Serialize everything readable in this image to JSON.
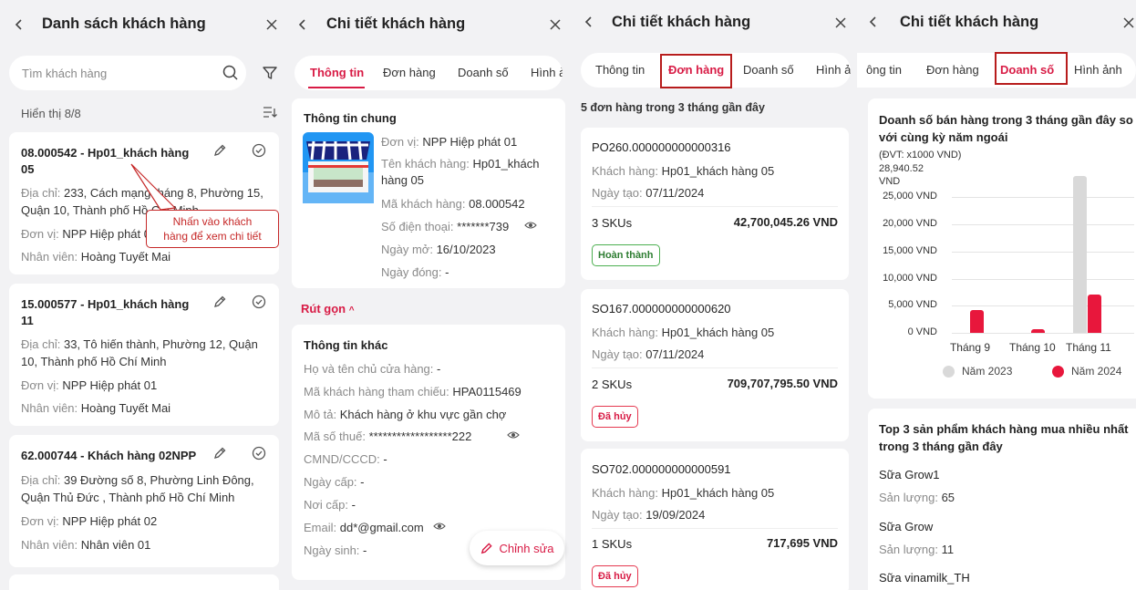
{
  "list_panel": {
    "title": "Danh sách khách hàng",
    "search_placeholder": "Tìm khách hàng",
    "count_text": "Hiển thị 8/8",
    "tooltip": "Nhấn vào khách\nhàng để xem chi tiết",
    "customers": [
      {
        "title": "08.000542 - Hp01_khách hàng 05",
        "address_label": "Địa chỉ:",
        "address": "233, Cách mạng tháng 8, Phường 15, Quận 10, Thành phố Hồ Chí Minh",
        "unit_label": "Đơn vị:",
        "unit": "NPP Hiệp phát 01",
        "staff_label": "Nhân viên:",
        "staff": "Hoàng Tuyết Mai"
      },
      {
        "title": "15.000577 - Hp01_khách hàng 11",
        "address_label": "Địa chỉ:",
        "address": "33, Tô hiến thành, Phường 12, Quận 10, Thành phố Hồ Chí Minh",
        "unit_label": "Đơn vị:",
        "unit": "NPP Hiệp phát 01",
        "staff_label": "Nhân viên:",
        "staff": "Hoàng Tuyết Mai"
      },
      {
        "title": "62.000744 - Khách hàng 02NPP",
        "address_label": "Địa chỉ:",
        "address": "39 Đường số 8, Phường Linh Đông, Quận Thủ Đức , Thành phố Hồ Chí Minh",
        "unit_label": "Đơn vị:",
        "unit": "NPP Hiệp phát 02",
        "staff_label": "Nhân viên:",
        "staff": "Nhân viên 01"
      }
    ]
  },
  "detail_panel": {
    "title": "Chi tiết khách hàng",
    "tabs": [
      "Thông tin",
      "Đơn hàng",
      "Doanh số",
      "Hình ả"
    ],
    "general_title": "Thông tin chung",
    "general": [
      {
        "label": "Đơn vị:",
        "value": "NPP Hiệp phát 01"
      },
      {
        "label": "Tên khách hàng:",
        "value": "Hp01_khách hàng 05"
      },
      {
        "label": "Mã khách hàng:",
        "value": "08.000542"
      },
      {
        "label": "Số điện thoại:",
        "value": "*******739"
      },
      {
        "label": "Ngày mở:",
        "value": "16/10/2023"
      },
      {
        "label": "Ngày đóng:",
        "value": "-"
      }
    ],
    "collapse_label": "Rút gọn",
    "other_title": "Thông tin khác",
    "other": [
      {
        "label": "Họ và tên chủ cửa hàng:",
        "value": "-"
      },
      {
        "label": "Mã khách hàng tham chiếu:",
        "value": "HPA0115469"
      },
      {
        "label": "Mô tả:",
        "value": "Khách hàng ở khu vực gần chợ"
      },
      {
        "label": "Mã số thuế:",
        "value": "******************222"
      },
      {
        "label": "CMND/CCCD:",
        "value": "-"
      },
      {
        "label": "Ngày cấp:",
        "value": "-"
      },
      {
        "label": "Nơi cấp:",
        "value": "-"
      },
      {
        "label": "Email:",
        "value": "dd*@gmail.com"
      },
      {
        "label": "Ngày sinh:",
        "value": "-"
      }
    ],
    "edit_label": "Chỉnh sửa"
  },
  "orders_panel": {
    "title": "Chi tiết khách hàng",
    "tabs": [
      "Thông tin",
      "Đơn hàng",
      "Doanh số",
      "Hình ả"
    ],
    "summary": "5 đơn hàng trong 3 tháng gần đây",
    "orders": [
      {
        "code": "PO260.000000000000316",
        "customer_label": "Khách hàng:",
        "customer": "Hp01_khách hàng 05",
        "date_label": "Ngày tạo:",
        "date": "07/11/2024",
        "skus": "3 SKUs",
        "amount": "42,700,045.26 VND",
        "status": "Hoàn thành"
      },
      {
        "code": "SO167.000000000000620",
        "customer_label": "Khách hàng:",
        "customer": "Hp01_khách hàng 05",
        "date_label": "Ngày tạo:",
        "date": "07/11/2024",
        "skus": "2 SKUs",
        "amount": "709,707,795.50 VND",
        "status": "Đã hủy"
      },
      {
        "code": "SO702.000000000000591",
        "customer_label": "Khách hàng:",
        "customer": "Hp01_khách hàng 05",
        "date_label": "Ngày tạo:",
        "date": "19/09/2024",
        "skus": "1 SKUs",
        "amount": "717,695 VND",
        "status": "Đã hủy"
      }
    ]
  },
  "sales_panel": {
    "title": "Chi tiết khách hàng",
    "tabs": [
      "ông tin",
      "Đơn hàng",
      "Doanh số",
      "Hình ảnh"
    ],
    "top_title": "Top 3 sản phẩm khách hàng mua nhiều nhất trong 3 tháng gần đây",
    "qty_label": "Sản lượng:",
    "products": [
      {
        "name": "Sữa Grow1",
        "qty": "65"
      },
      {
        "name": "Sữa Grow",
        "qty": "11"
      },
      {
        "name": "Sữa vinamilk_TH",
        "qty": ""
      }
    ]
  },
  "colors": {
    "accent": "#d81b45",
    "bar_2023": "#d9d9d9",
    "bar_2024": "#e8173c",
    "highlight_box": "#b71c1c"
  },
  "chart_data": {
    "type": "bar",
    "title": "Doanh số bán hàng trong 3 tháng gần đây so với cùng kỳ năm ngoái",
    "unit_note": "(ĐVT: x1000 VND)",
    "max_label": "28,940.52 VND",
    "ylim": [
      0,
      28940.52
    ],
    "yticks": [
      "25,000 VND",
      "20,000 VND",
      "15,000 VND",
      "10,000 VND",
      "5,000 VND",
      "0 VND"
    ],
    "ytick_values": [
      25000,
      20000,
      15000,
      10000,
      5000,
      0
    ],
    "categories": [
      "Tháng 9",
      "Tháng 10",
      "Tháng 11"
    ],
    "series": [
      {
        "name": "Năm 2023",
        "values": [
          0,
          0,
          28940.52
        ]
      },
      {
        "name": "Năm 2024",
        "values": [
          4200,
          700,
          7000
        ]
      }
    ],
    "legend": "bottom"
  }
}
